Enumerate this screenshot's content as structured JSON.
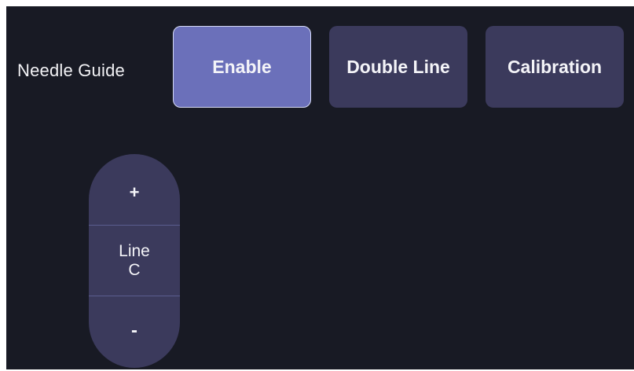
{
  "panel": {
    "title": "Needle Guide"
  },
  "buttons": {
    "enable": "Enable",
    "double_line": "Double Line",
    "calibration": "Calibration"
  },
  "line_stepper": {
    "increment": "+",
    "label_line1": "Line",
    "label_line2": "C",
    "decrement": "-"
  },
  "colors": {
    "panel_bg": "#181a24",
    "button_bg": "#3b3a5c",
    "button_active": "#6b70ba",
    "text": "#f4f4f8"
  }
}
